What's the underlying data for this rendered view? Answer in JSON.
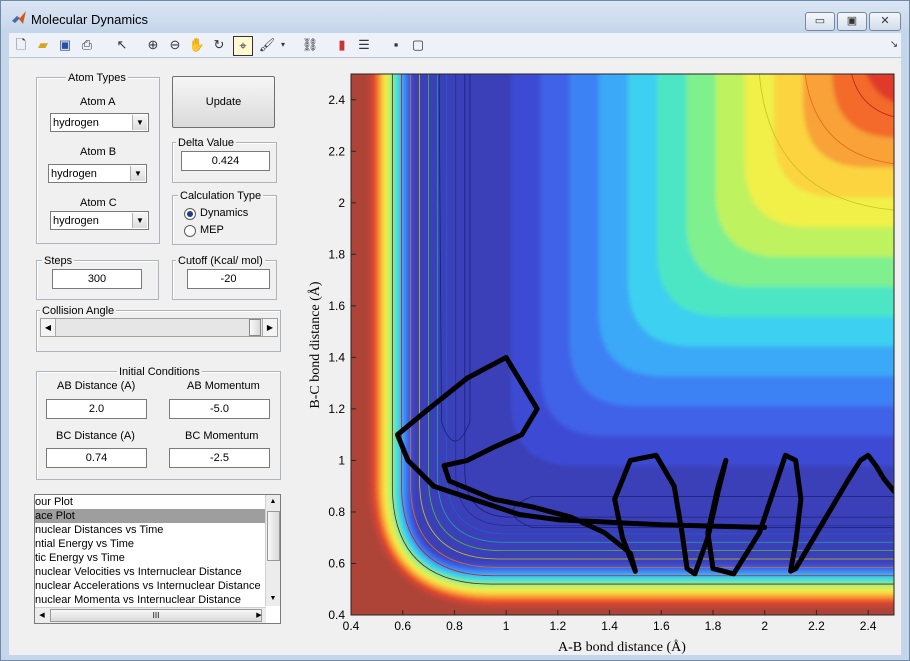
{
  "window": {
    "title": "Molecular Dynamics",
    "buttons": {
      "minimize": "▭",
      "maximize": "▣",
      "close": "✕"
    }
  },
  "toolbar": {
    "icons": [
      "new-file-icon",
      "open-folder-icon",
      "save-icon",
      "print-icon",
      "pointer-icon",
      "zoom-in-icon",
      "zoom-out-icon",
      "pan-hand-icon",
      "rotate-3d-icon",
      "data-cursor-icon",
      "brush-icon",
      "link-plot-icon",
      "colorbar-icon",
      "legend-icon",
      "hide-tools-icon",
      "show-tools-icon"
    ]
  },
  "atom_types": {
    "title": "Atom Types",
    "atom_a": {
      "label": "Atom A",
      "value": "hydrogen"
    },
    "atom_b": {
      "label": "Atom B",
      "value": "hydrogen"
    },
    "atom_c": {
      "label": "Atom C",
      "value": "hydrogen"
    }
  },
  "update_button": "Update",
  "delta": {
    "title": "Delta Value",
    "value": "0.424"
  },
  "calc_type": {
    "title": "Calculation Type",
    "options": [
      {
        "label": "Dynamics",
        "selected": true
      },
      {
        "label": "MEP",
        "selected": false
      }
    ]
  },
  "steps": {
    "title": "Steps",
    "value": "300"
  },
  "cutoff": {
    "title": "Cutoff (Kcal/ mol)",
    "value": "-20"
  },
  "collision": {
    "title": "Collision Angle"
  },
  "initial": {
    "title": "Initial Conditions",
    "ab_distance": {
      "label": "AB Distance (A)",
      "value": "2.0"
    },
    "ab_momentum": {
      "label": "AB Momentum",
      "value": "-5.0"
    },
    "bc_distance": {
      "label": "BC Distance (A)",
      "value": "0.74"
    },
    "bc_momentum": {
      "label": "BC Momentum",
      "value": "-2.5"
    }
  },
  "plot_list": {
    "items": [
      "our Plot",
      "ace Plot",
      "nuclear Distances vs Time",
      "ntial Energy vs Time",
      "tic Energy vs Time",
      "nuclear Velocities vs Internuclear Distance",
      "nuclear Accelerations vs Internuclear Distance",
      "nuclear Momenta vs Internuclear Distance"
    ],
    "selected_index": 1,
    "hscroll_grip": "III"
  },
  "chart_data": {
    "type": "contour",
    "xlabel": "A-B bond distance (Å)",
    "ylabel": "B-C bond distance (Å)",
    "xlim": [
      0.4,
      2.5
    ],
    "ylim": [
      0.4,
      2.5
    ],
    "xticks": [
      "0.4",
      "0.6",
      "0.8",
      "1",
      "1.2",
      "1.4",
      "1.6",
      "1.8",
      "2",
      "2.2",
      "2.4"
    ],
    "yticks": [
      "0.4",
      "0.6",
      "0.8",
      "1",
      "1.2",
      "1.4",
      "1.6",
      "1.8",
      "2",
      "2.2",
      "2.4"
    ],
    "colormap": "jet",
    "trajectory": {
      "x": [
        2.0,
        1.8,
        1.6,
        1.4,
        1.2,
        1.05,
        0.9,
        0.72,
        0.62,
        0.58,
        0.7,
        0.85,
        1.0,
        1.12,
        1.06,
        0.95,
        0.85,
        0.76,
        0.78,
        0.95,
        1.1,
        1.25,
        1.38,
        1.48,
        1.5,
        1.45,
        1.42,
        1.48,
        1.58,
        1.65,
        1.68,
        1.7,
        1.73,
        1.78,
        1.82,
        1.85,
        1.82,
        1.78,
        1.8,
        1.88,
        1.98,
        2.04,
        2.08,
        2.12,
        2.14,
        2.12,
        2.1,
        2.12,
        2.22,
        2.32,
        2.37,
        2.4,
        2.43,
        2.46,
        2.5
      ],
      "y": [
        0.74,
        0.745,
        0.75,
        0.76,
        0.77,
        0.79,
        0.84,
        0.9,
        1.0,
        1.1,
        1.2,
        1.32,
        1.4,
        1.2,
        1.1,
        1.05,
        1.0,
        0.98,
        0.92,
        0.85,
        0.82,
        0.78,
        0.72,
        0.64,
        0.57,
        0.7,
        0.85,
        1.0,
        1.02,
        0.9,
        0.72,
        0.58,
        0.56,
        0.7,
        0.88,
        1.0,
        0.9,
        0.72,
        0.58,
        0.56,
        0.72,
        0.9,
        1.02,
        1.0,
        0.85,
        0.68,
        0.57,
        0.58,
        0.75,
        0.92,
        1.0,
        1.02,
        0.98,
        0.93,
        0.88
      ]
    }
  }
}
